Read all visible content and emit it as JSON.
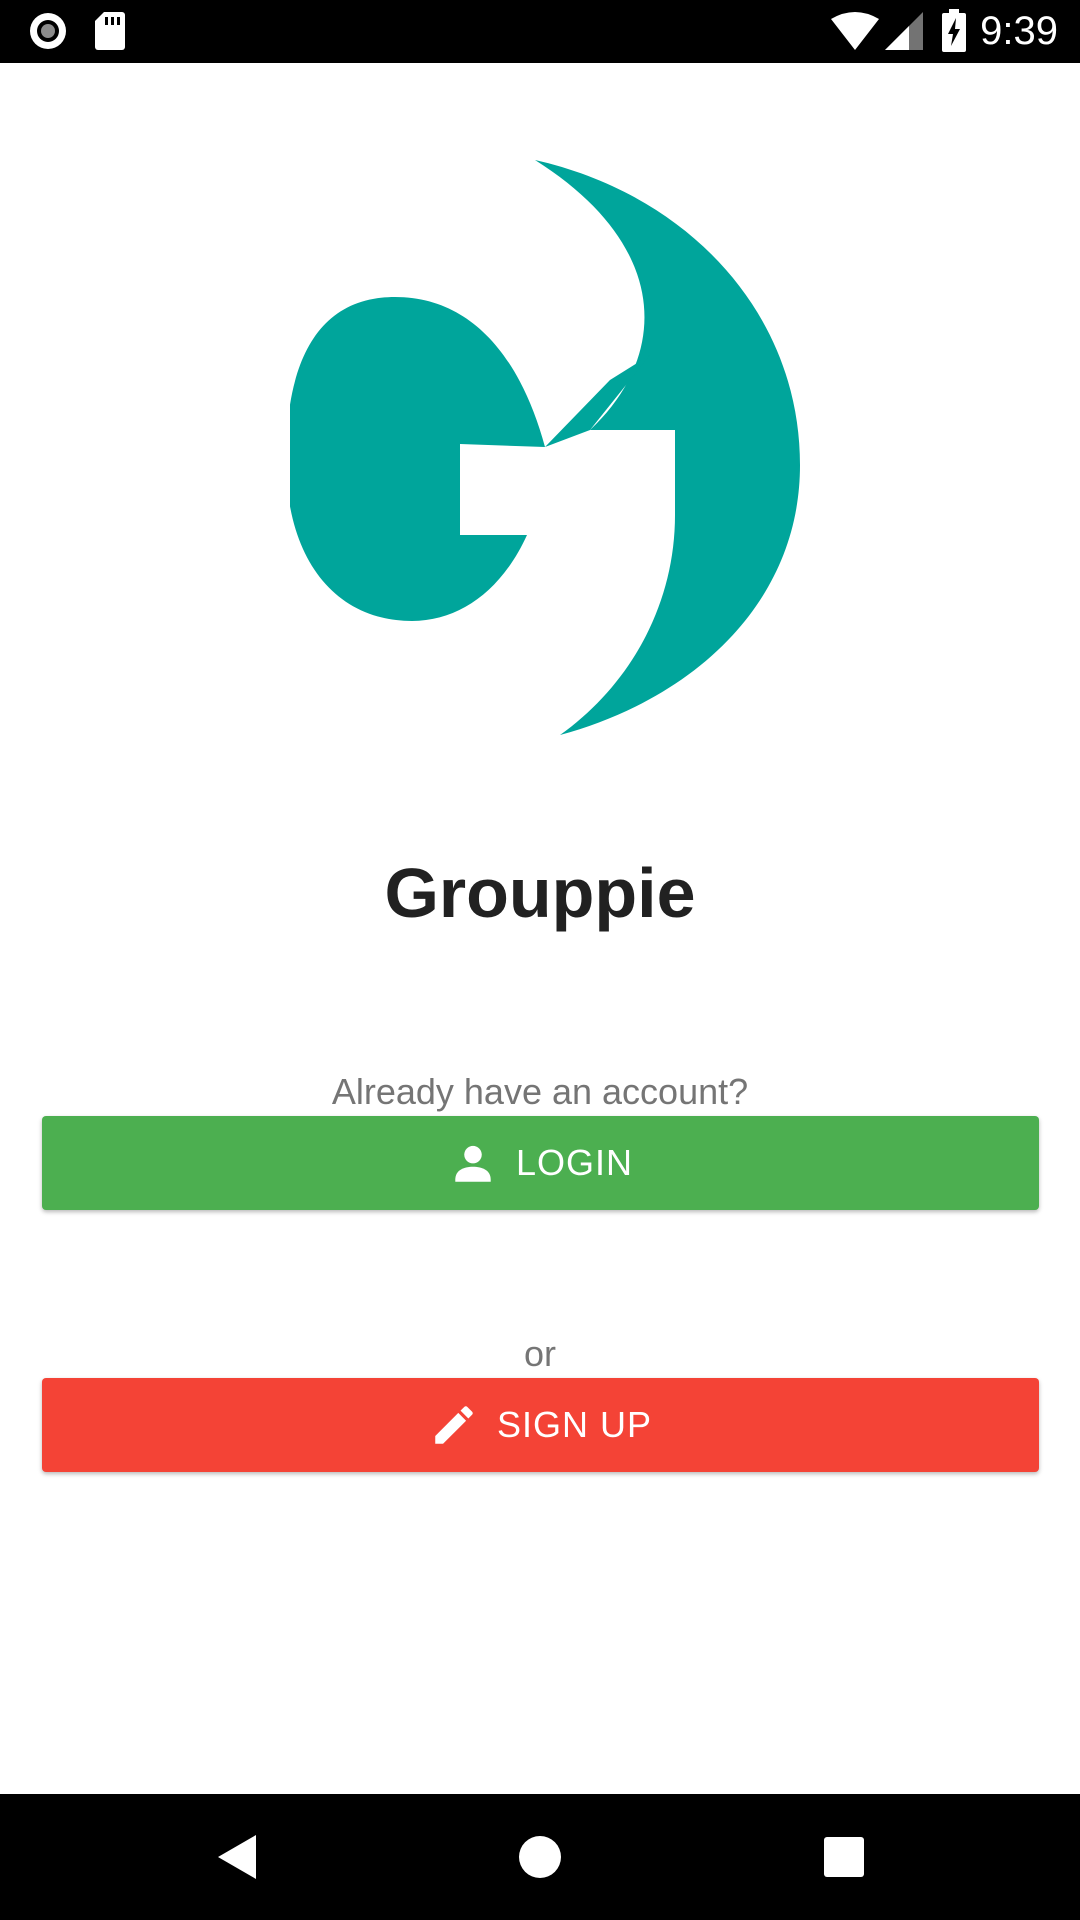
{
  "status_bar": {
    "time": "9:39",
    "icons": [
      "record-icon",
      "sd-card-icon",
      "wifi-icon",
      "cell-signal-icon",
      "battery-charging-icon"
    ]
  },
  "app": {
    "logo_icon": "grouppie-logo-icon",
    "title": "Grouppie",
    "brand_color": "#00A59B"
  },
  "auth": {
    "prompt": "Already have an account?",
    "login_label": "LOGIN",
    "login_icon": "person-icon",
    "login_color": "#4CAF50",
    "or_text": "or",
    "signup_label": "SIGN UP",
    "signup_icon": "pencil-icon",
    "signup_color": "#F44336"
  },
  "nav_bar": {
    "icons": [
      "back-icon",
      "home-icon",
      "recents-icon"
    ]
  }
}
